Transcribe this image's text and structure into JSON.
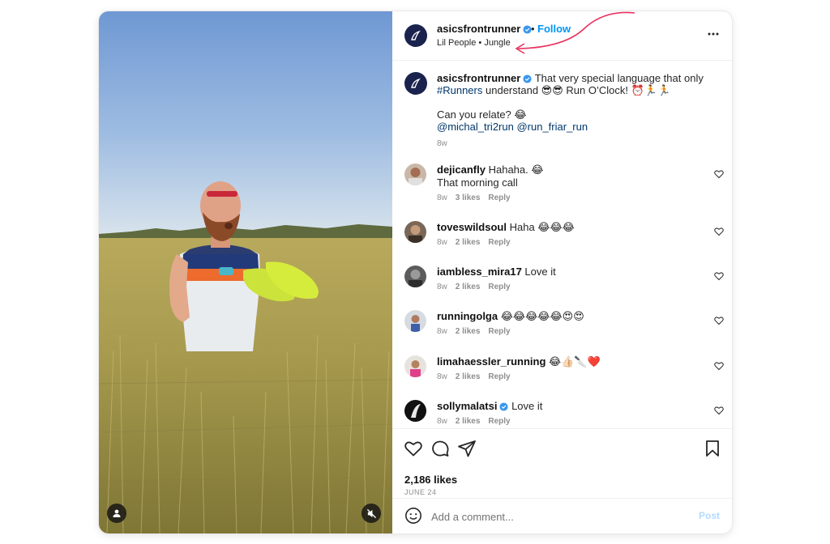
{
  "colors": {
    "accent": "#0095f6",
    "brand_avatar": "#19234d",
    "link": "#00376b",
    "muted": "#8e8e8e",
    "annotation_arrow": "#e8325f",
    "post_disabled": "#b3dbff"
  },
  "header": {
    "username": "asicsfrontrunner",
    "separator": "•",
    "follow_label": "Follow",
    "music_artist": "Lil People",
    "music_separator": "•",
    "music_track": "Jungle",
    "more_icon": "more-horizontal-icon"
  },
  "caption": {
    "username": "asicsfrontrunner",
    "text_line1": "That very special language that only",
    "hashtag": "#Runners",
    "text_line2_rest": "understand 😎😎 Run O’Clock! ⏰🏃🏃",
    "text_line3": "Can you relate? 😂",
    "mention1": "@michal_tri2run",
    "mention2": "@run_friar_run",
    "time": "8w"
  },
  "comments": [
    {
      "username": "dejicanfly",
      "text": "Hahaha. 😂",
      "text2": "That morning call",
      "time": "8w",
      "likes": "3 likes",
      "reply": "Reply"
    },
    {
      "username": "toveswildsoul",
      "text": "Haha 😂😂😂",
      "time": "8w",
      "likes": "2 likes",
      "reply": "Reply"
    },
    {
      "username": "iambless_mira17",
      "text": "Love it",
      "time": "8w",
      "likes": "2 likes",
      "reply": "Reply"
    },
    {
      "username": "runningolga",
      "text": "😂😂😂😂😂😍😍",
      "time": "8w",
      "likes": "2 likes",
      "reply": "Reply"
    },
    {
      "username": "limahaessler_running",
      "text": "😂👍🏻🔪❤️",
      "time": "8w",
      "likes": "2 likes",
      "reply": "Reply"
    },
    {
      "username": "sollymalatsi",
      "text": "Love it",
      "time": "8w",
      "likes": "2 likes",
      "reply": "Reply"
    }
  ],
  "actions": {
    "likes_count": "2,186 likes",
    "date": "JUNE 24",
    "icons": [
      "heart-icon",
      "comment-icon",
      "share-icon",
      "bookmark-icon"
    ]
  },
  "composer": {
    "placeholder": "Add a comment...",
    "post_label": "Post",
    "emoji_icon": "smiley-icon"
  }
}
